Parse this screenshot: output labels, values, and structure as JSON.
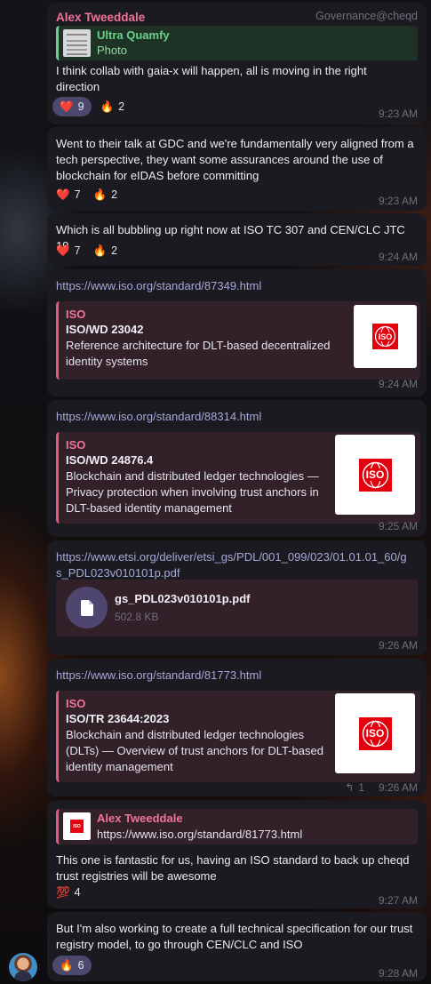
{
  "chat_tag": "Governance@cheqd",
  "messages": [
    {
      "sender": "Alex Tweeddale",
      "reply_name": "Ultra Quamfy",
      "reply_type": "Photo",
      "text": "I think collab with gaia-x will happen, all is moving in the right direction",
      "reactions": [
        {
          "emoji": "❤️",
          "count": "9"
        },
        {
          "emoji": "🔥",
          "count": "2"
        }
      ],
      "time": "9:23 AM"
    },
    {
      "text": "Went to their talk at GDC and we're fundamentally very aligned from a tech perspective, they want some assurances around the use of blockchain for eIDAS before committing",
      "reactions": [
        {
          "emoji": "❤️",
          "count": "7"
        },
        {
          "emoji": "🔥",
          "count": "2"
        }
      ],
      "time": "9:23 AM"
    },
    {
      "text": "Which is all bubbling up right now at ISO TC 307 and CEN/CLC JTC 19",
      "reactions": [
        {
          "emoji": "❤️",
          "count": "7"
        },
        {
          "emoji": "🔥",
          "count": "2"
        }
      ],
      "time": "9:24 AM"
    },
    {
      "link": "https://www.iso.org/standard/87349.html",
      "preview_site": "ISO",
      "preview_title": "ISO/WD 23042",
      "preview_desc": "Reference architecture for DLT-based decentralized identity systems",
      "time": "9:24 AM"
    },
    {
      "link": "https://www.iso.org/standard/88314.html",
      "preview_site": "ISO",
      "preview_title": "ISO/WD 24876.4",
      "preview_desc": "Blockchain and distributed ledger technologies — Privacy protection when involving trust anchors in DLT-based identity management",
      "time": "9:25 AM"
    },
    {
      "link_line1": "https://www.etsi.org/deliver/etsi_gs/PDL/001_099/023/01.01.01_60/g",
      "link_line2": "s_PDL023v010101p.pdf",
      "file_name": "gs_PDL023v010101p.pdf",
      "file_size": "502.8 KB",
      "time": "9:26 AM"
    },
    {
      "link": "https://www.iso.org/standard/81773.html",
      "preview_site": "ISO",
      "preview_title": "ISO/TR 23644:2023",
      "preview_desc": "Blockchain and distributed ledger technologies (DLTs) — Overview of trust anchors for DLT-based identity management",
      "replies": "1",
      "time": "9:26 AM"
    },
    {
      "reply_name": "Alex Tweeddale",
      "reply_text": "https://www.iso.org/standard/81773.html",
      "text": "This one is fantastic for us, having an ISO standard to back up cheqd trust registries will be awesome",
      "reactions": [
        {
          "emoji": "💯",
          "count": "4"
        }
      ],
      "time": "9:27 AM"
    },
    {
      "text": "But I'm also working to create a full technical specification for our trust registry model, to go through CEN/CLC and ISO",
      "reactions": [
        {
          "emoji": "🔥",
          "count": "6"
        }
      ],
      "time": "9:28 AM"
    }
  ],
  "iso_logo_text": "ISO",
  "colors": {
    "accent": "#f0739a",
    "link": "#a6a8d8",
    "bubble": "#1b1a21",
    "iso_red": "#e3000f"
  }
}
